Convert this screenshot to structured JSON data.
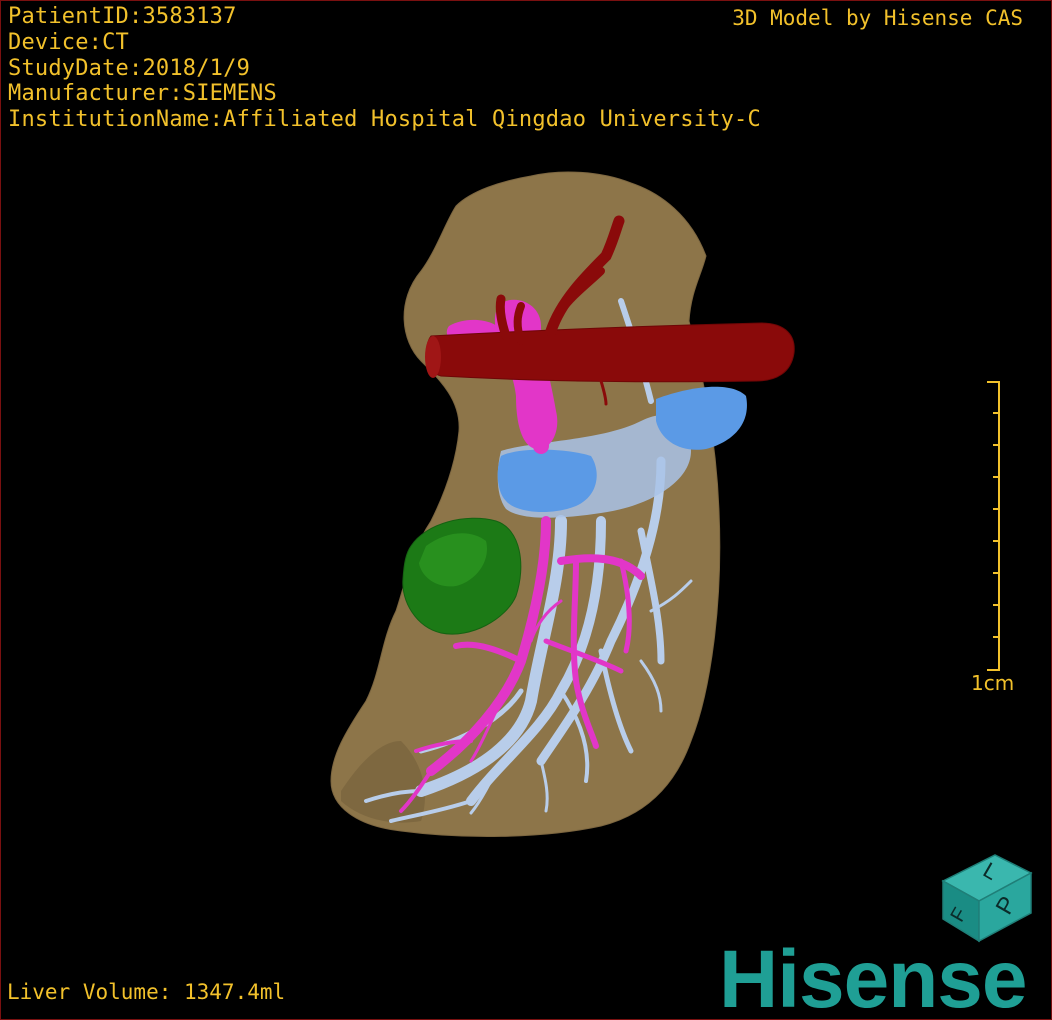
{
  "patient": {
    "id_line": "PatientID:3583137",
    "device_line": "Device:CT",
    "study_date_line": "StudyDate:2018/1/9",
    "manufacturer_line": "Manufacturer:SIEMENS",
    "institution_line": "InstitutionName:Affiliated Hospital Qingdao University-C"
  },
  "brand": {
    "model_credit": "3D Model by Hisense CAS",
    "logo_text": "Hisense",
    "logo_color": "#1f9f95"
  },
  "stats": {
    "liver_volume": "Liver Volume: 1347.4ml"
  },
  "scale_bar": {
    "label": "1cm",
    "color": "#f2c12b"
  },
  "orientation_cube": {
    "face_letters": [
      "L",
      "P",
      "F"
    ]
  },
  "colors": {
    "overlay_text": "#f2c12b",
    "liver": "#8d7549",
    "vena_cava": "#8a0a0a",
    "portal_vein": "#e236c8",
    "hepatic_vein": "#b8cdea",
    "gallbladder_blue": "#5b9ae6",
    "tumor": "#1c7a16",
    "viewport_border": "#7a1010"
  }
}
